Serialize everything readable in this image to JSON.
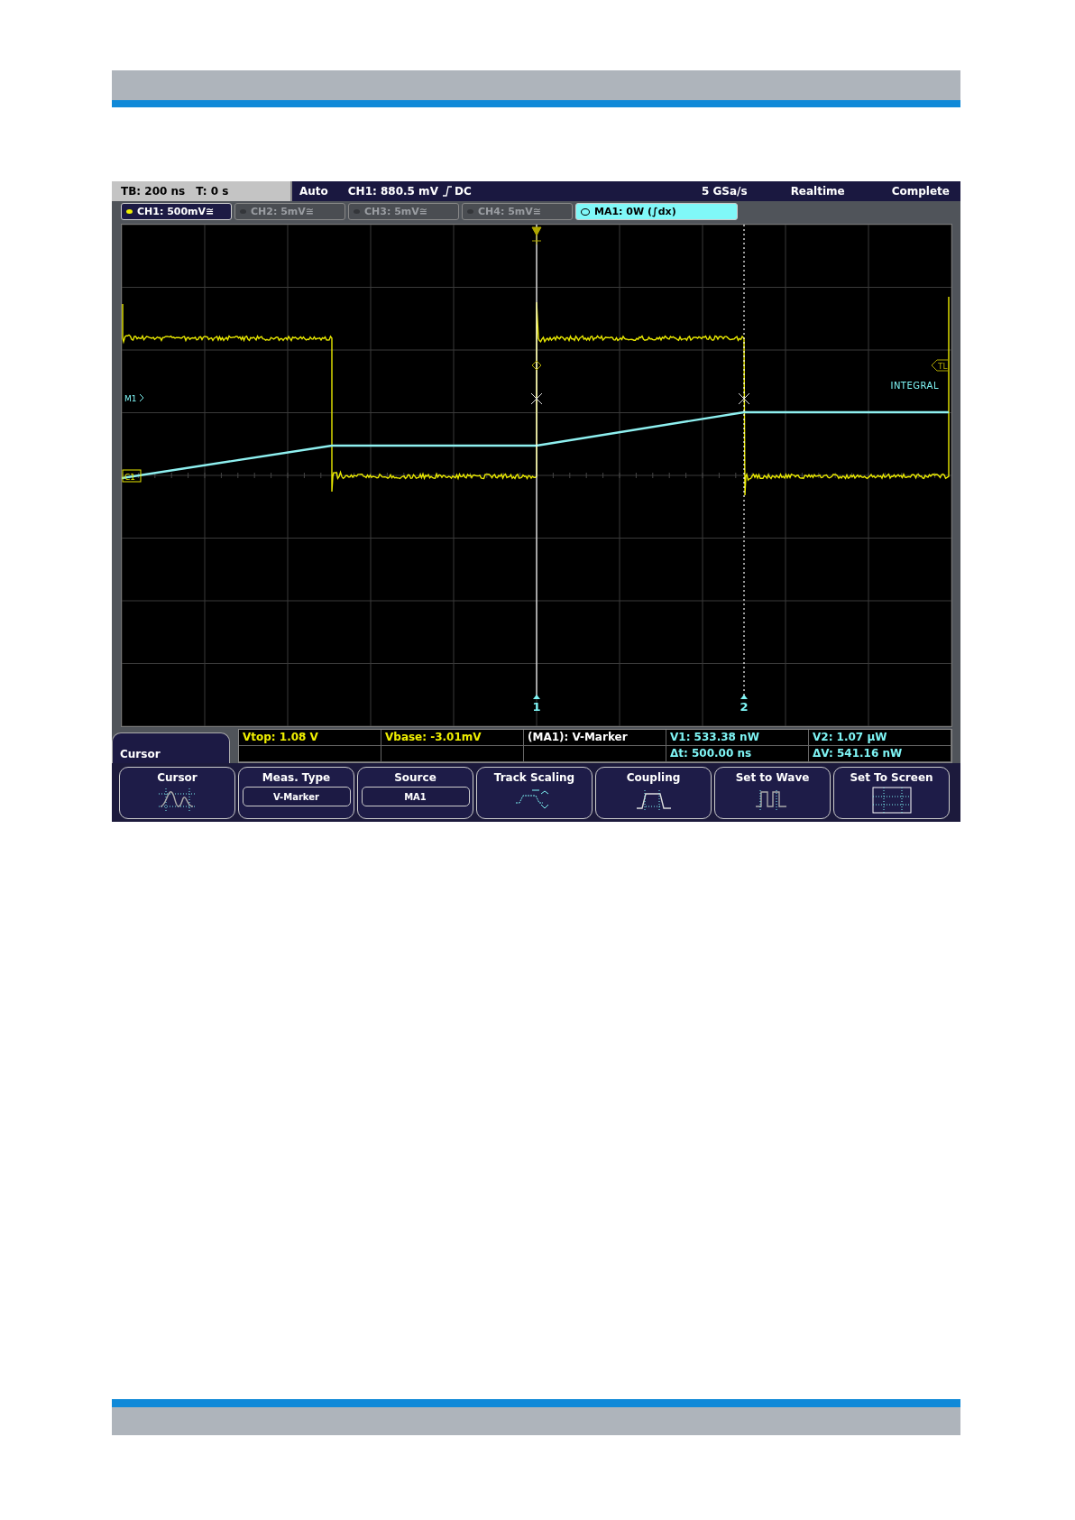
{
  "status_bar": {
    "timebase": "TB: 200 ns",
    "trigger_time": "T: 0 s",
    "mode": "Auto",
    "trigger": "CH1: 880.5 mV",
    "coupling": "DC",
    "sample_rate": "5 GSa/s",
    "acquisition": "Realtime",
    "state": "Complete"
  },
  "channels": [
    {
      "label": "CH1: 500mV≅",
      "active": true,
      "selected": false
    },
    {
      "label": "CH2: 5mV≅",
      "active": false,
      "selected": false
    },
    {
      "label": "CH3: 5mV≅",
      "active": false,
      "selected": false
    },
    {
      "label": "CH4: 5mV≅",
      "active": false,
      "selected": false
    },
    {
      "label": "MA1: 0W (∫dx)",
      "active": true,
      "selected": true
    }
  ],
  "plot": {
    "markers": [
      {
        "label": "M1",
        "kind": "math"
      },
      {
        "label": "C1",
        "kind": "channel"
      },
      {
        "label": "TL",
        "kind": "trigger"
      }
    ],
    "trace_label": "INTEGRAL",
    "cursors": [
      {
        "label": "1",
        "kind": "solid"
      },
      {
        "label": "2",
        "kind": "dotted"
      }
    ]
  },
  "menu": {
    "title": "Cursor"
  },
  "measurements": {
    "row_1": [
      {
        "text": "Vtop: 1.08 V",
        "kind": "channel"
      },
      {
        "text": "Vbase: -3.01mV",
        "kind": "channel"
      },
      {
        "text": "(MA1): V-Marker",
        "kind": "label"
      },
      {
        "text": "V1: 533.38 nW",
        "kind": "cursor"
      },
      {
        "text": "V2: 1.07 µW",
        "kind": "cursor"
      }
    ],
    "row_2": [
      {
        "text": "Δt: 500.00 ns",
        "kind": "cursor"
      },
      {
        "text": "ΔV: 541.16 nW",
        "kind": "cursor"
      }
    ]
  },
  "softkeys": [
    {
      "label": "Cursor",
      "kind": "icon"
    },
    {
      "label": "Meas. Type",
      "kind": "value",
      "value": "V-Marker"
    },
    {
      "label": "Source",
      "kind": "value",
      "value": "MA1"
    },
    {
      "label": "Track Scaling",
      "kind": "icon"
    },
    {
      "label": "Coupling",
      "kind": "icon"
    },
    {
      "label": "Set to Wave",
      "kind": "icon"
    },
    {
      "label": "Set To Screen",
      "kind": "icon"
    }
  ]
}
